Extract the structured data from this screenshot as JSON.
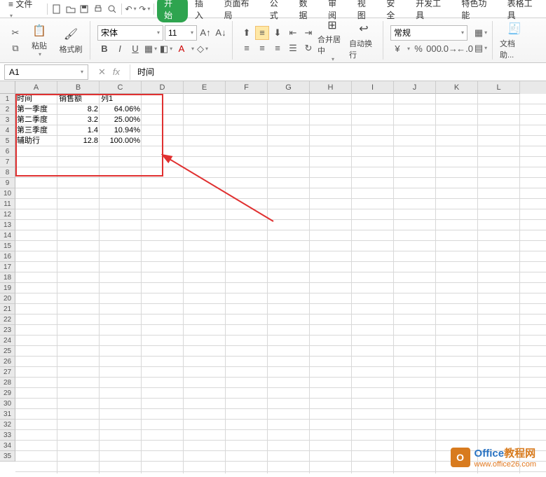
{
  "menu": {
    "file": "文件",
    "tabs": [
      "开始",
      "插入",
      "页面布局",
      "公式",
      "数据",
      "审阅",
      "视图",
      "安全",
      "开发工具",
      "特色功能",
      "表格工具"
    ]
  },
  "ribbon": {
    "paste": "粘贴",
    "format_painter": "格式刷",
    "font_name": "宋体",
    "font_size": "11",
    "merge": "合并居中",
    "wrap": "自动换行",
    "number_format": "常规",
    "doc_assistant": "文档助..."
  },
  "namebox": "A1",
  "formula": "时间",
  "columns": [
    "A",
    "B",
    "C",
    "D",
    "E",
    "F",
    "G",
    "H",
    "I",
    "J",
    "K",
    "L"
  ],
  "row_count": 35,
  "sheet": {
    "headers": [
      "时间",
      "销售额",
      "列1"
    ],
    "rows": [
      {
        "label": "第一季度",
        "value": "8.2",
        "pct": "64.06%"
      },
      {
        "label": "第二季度",
        "value": "3.2",
        "pct": "25.00%"
      },
      {
        "label": "第三季度",
        "value": "1.4",
        "pct": "10.94%"
      },
      {
        "label": "辅助行",
        "value": "12.8",
        "pct": "100.00%"
      }
    ]
  },
  "watermark": {
    "title1": "Office",
    "title2": "教程网",
    "url": "www.office26.com"
  },
  "icons": {
    "bold": "B",
    "italic": "I",
    "underline": "U",
    "strike": "A",
    "currency": "¥",
    "percent": "%",
    "comma": "000"
  }
}
